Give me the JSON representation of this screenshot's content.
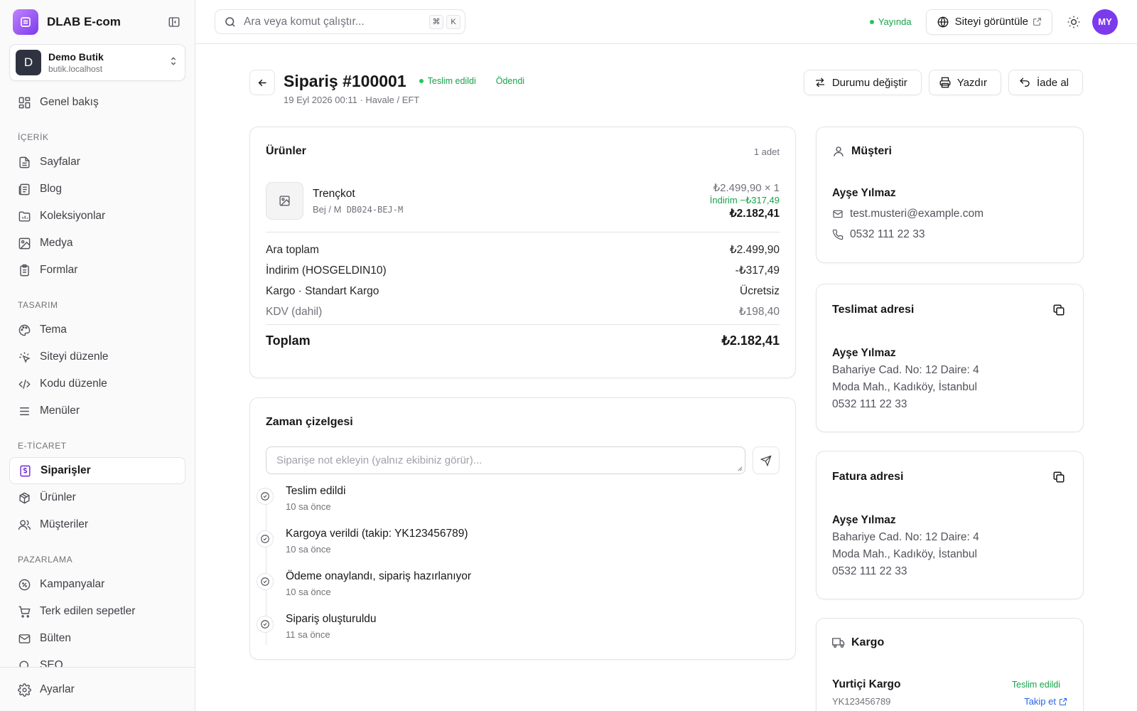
{
  "brand": {
    "name": "DLAB E-com"
  },
  "workspace": {
    "initial": "D",
    "name": "Demo Butik",
    "host": "butik.localhost"
  },
  "sidebar": {
    "overview": "Genel bakış",
    "sections": {
      "content": "İÇERİK",
      "design": "TASARIM",
      "ecommerce": "E-TİCARET",
      "marketing": "PAZARLAMA"
    },
    "content": [
      "Sayfalar",
      "Blog",
      "Koleksiyonlar",
      "Medya",
      "Formlar"
    ],
    "design": [
      "Tema",
      "Siteyi düzenle",
      "Kodu düzenle",
      "Menüler"
    ],
    "ecommerce": [
      "Siparişler",
      "Ürünler",
      "Müşteriler"
    ],
    "marketing": [
      "Kampanyalar",
      "Terk edilen sepetler",
      "Bülten",
      "SEO"
    ],
    "settings": "Ayarlar"
  },
  "topbar": {
    "search_placeholder": "Ara veya komut çalıştır...",
    "kbd1": "⌘",
    "kbd2": "K",
    "status": "Yayında",
    "view_site": "Siteyi görüntüle",
    "user_initials": "MY"
  },
  "order": {
    "title": "Sipariş #100001",
    "status": "Teslim edildi",
    "payment": "Ödendi",
    "subtitle": "19 Eyl 2026 00:11 · Havale / EFT",
    "actions": {
      "change_status": "Durumu değiştir",
      "print": "Yazdır",
      "refund": "İade al"
    }
  },
  "items": {
    "title": "Ürünler",
    "count": "1 adet",
    "product": {
      "name": "Trençkot",
      "variant": "Bej / M",
      "sku": "DB024-BEJ-M",
      "unit": "₺2.499,90 × 1",
      "discount": "İndirim −₺317,49",
      "total": "₺2.182,41"
    },
    "summary": [
      {
        "label": "Ara toplam",
        "value": "₺2.499,90"
      },
      {
        "label": "İndirim (HOSGELDIN10)",
        "value": "-₺317,49"
      },
      {
        "label": "Kargo · Standart Kargo",
        "value": "Ücretsiz"
      },
      {
        "label": "KDV (dahil)",
        "value": "₺198,40"
      }
    ],
    "total_label": "Toplam",
    "total_value": "₺2.182,41"
  },
  "timeline": {
    "title": "Zaman çizelgesi",
    "note_placeholder": "Siparişe not ekleyin (yalnız ekibiniz görür)...",
    "events": [
      {
        "title": "Teslim edildi",
        "time": "10 sa önce"
      },
      {
        "title": "Kargoya verildi (takip: YK123456789)",
        "time": "10 sa önce"
      },
      {
        "title": "Ödeme onaylandı, sipariş hazırlanıyor",
        "time": "10 sa önce"
      },
      {
        "title": "Sipariş oluşturuldu",
        "time": "11 sa önce"
      }
    ]
  },
  "customer": {
    "title": "Müşteri",
    "name": "Ayşe Yılmaz",
    "email": "test.musteri@example.com",
    "phone": "0532 111 22 33"
  },
  "shipping_address": {
    "title": "Teslimat adresi",
    "name": "Ayşe Yılmaz",
    "line1": "Bahariye Cad. No: 12 Daire: 4",
    "line2": "Moda Mah., Kadıköy, İstanbul",
    "phone": "0532 111 22 33"
  },
  "billing_address": {
    "title": "Fatura adresi",
    "name": "Ayşe Yılmaz",
    "line1": "Bahariye Cad. No: 12 Daire: 4",
    "line2": "Moda Mah., Kadıköy, İstanbul",
    "phone": "0532 111 22 33"
  },
  "shipment": {
    "title": "Kargo",
    "carrier": "Yurtiçi Kargo",
    "status": "Teslim edildi",
    "tracking": "YK123456789",
    "track_link": "Takip et"
  },
  "colors": {
    "accent": "#7c3aed",
    "success": "#16a34a",
    "link": "#2563eb"
  }
}
